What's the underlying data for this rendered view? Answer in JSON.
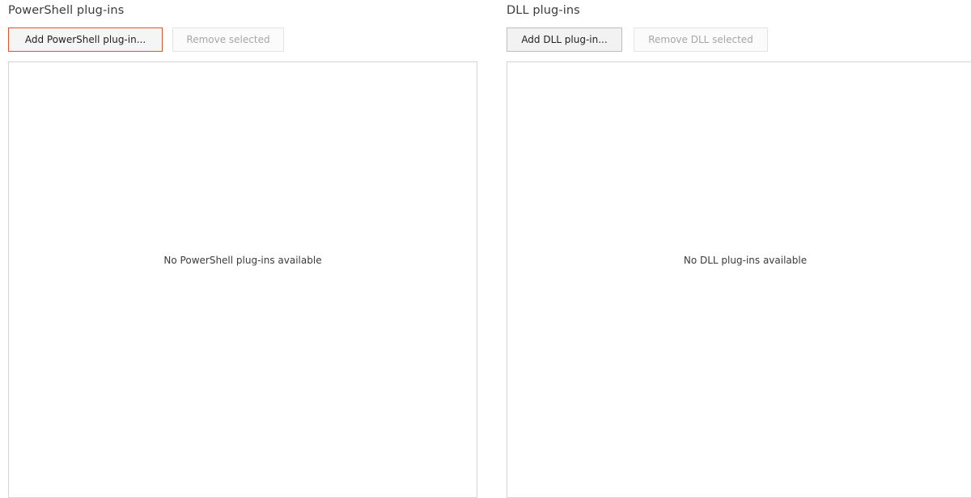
{
  "powershell": {
    "title": "PowerShell plug-ins",
    "add_button": "Add PowerShell plug-in...",
    "remove_button": "Remove selected",
    "empty_message": "No PowerShell plug-ins available"
  },
  "dll": {
    "title": "DLL plug-ins",
    "add_button": "Add DLL plug-in...",
    "remove_button": "Remove DLL selected",
    "empty_message": "No DLL plug-ins available"
  },
  "colors": {
    "focus_border": "#d8572b",
    "list_border": "#d4d4d4",
    "disabled_text": "#a6a6a6"
  }
}
